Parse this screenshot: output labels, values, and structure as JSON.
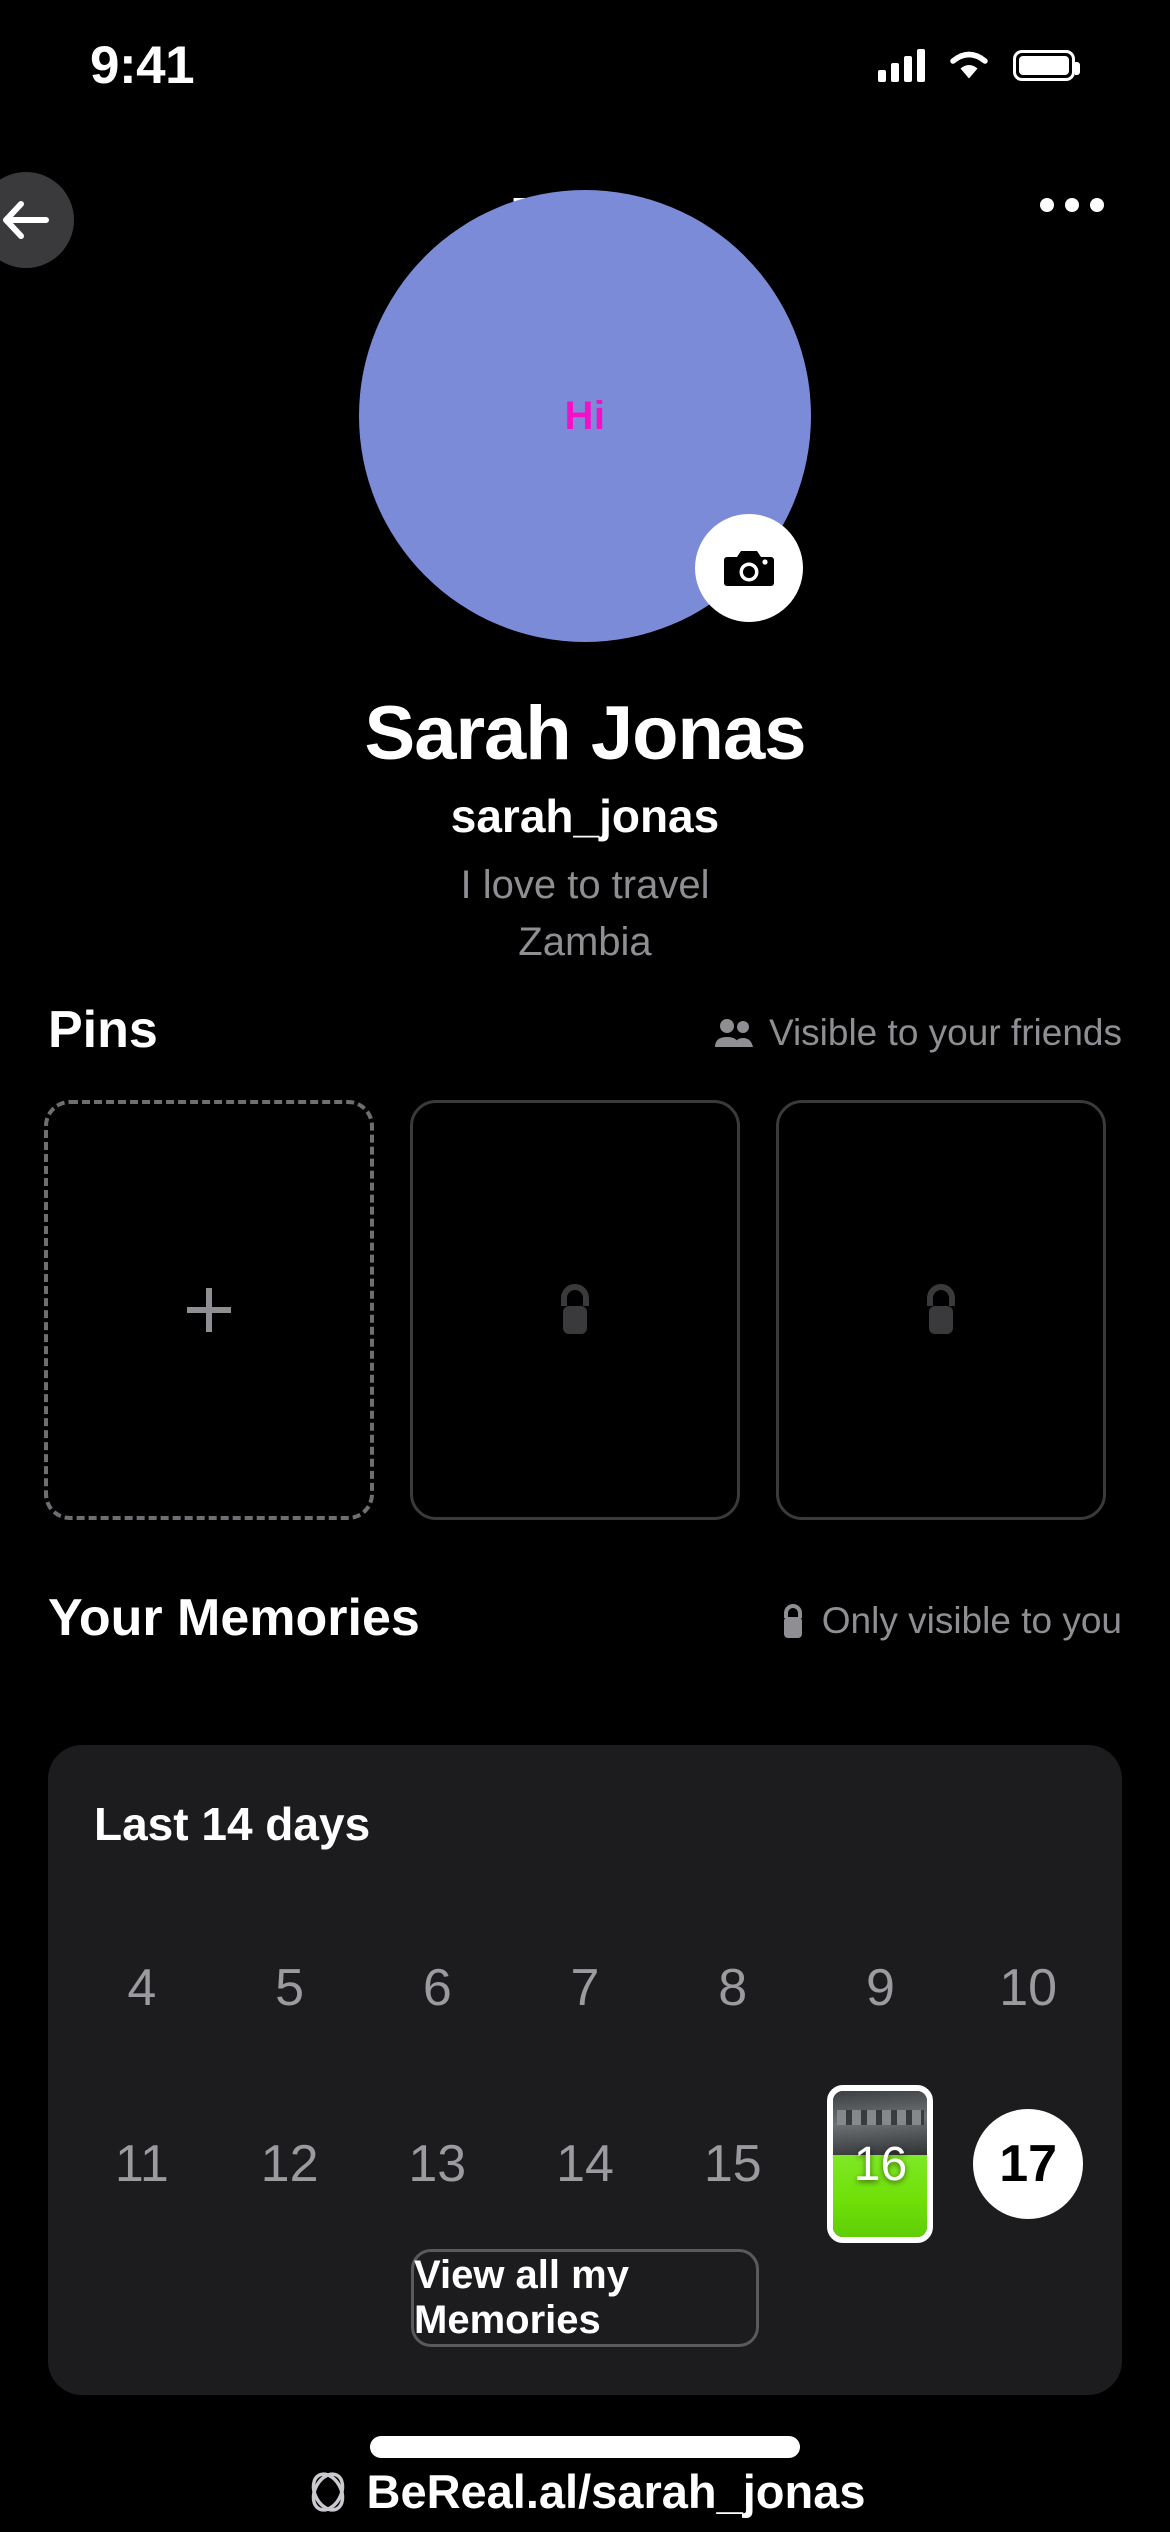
{
  "status_bar": {
    "time": "9:41",
    "cellular_icon": "cellular-bars-icon",
    "wifi_icon": "wifi-icon",
    "battery_icon": "battery-icon"
  },
  "nav": {
    "back_icon": "back-arrow-icon",
    "title": "Profile",
    "more_icon": "more-options-icon"
  },
  "avatar": {
    "placeholder_text": "Hi",
    "background_color": "#7B8BD8",
    "text_color": "#F410C8",
    "camera_icon": "camera-icon"
  },
  "identity": {
    "display_name": "Sarah Jonas",
    "username": "sarah_jonas",
    "bio": "I love to travel",
    "location": "Zambia"
  },
  "pins": {
    "title": "Pins",
    "visibility_note": "Visible to your friends",
    "visibility_icon": "people-icon",
    "cards": [
      {
        "type": "add",
        "icon": "plus-icon"
      },
      {
        "type": "locked",
        "icon": "lock-icon"
      },
      {
        "type": "locked",
        "icon": "lock-icon"
      }
    ]
  },
  "memories": {
    "title": "Your Memories",
    "visibility_note": "Only visible to you",
    "visibility_icon": "lock-icon",
    "card_title": "Last 14 days",
    "days_row_1": [
      "4",
      "5",
      "6",
      "7",
      "8",
      "9",
      "10"
    ],
    "days_row_2": [
      "11",
      "12",
      "13",
      "14",
      "15"
    ],
    "day_with_photo": "16",
    "day_today": "17",
    "view_all_label": "View all my Memories"
  },
  "footer": {
    "link_icon": "bereal-logo-icon",
    "link_text": "BeReal.al/sarah_jonas"
  }
}
